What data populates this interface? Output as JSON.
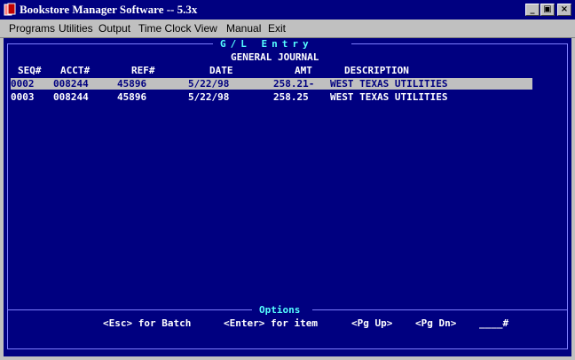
{
  "window": {
    "title": "Bookstore Manager Software -- 5.3x",
    "controls": [
      "_",
      "▣",
      "×"
    ]
  },
  "menu": [
    "Programs",
    "Utilities",
    "Output",
    "Time Clock",
    "View",
    "Manual",
    "Exit"
  ],
  "screen": {
    "frame_title": "G/L Entry",
    "subtitle": "GENERAL JOURNAL",
    "headers": {
      "seq": "SEQ#",
      "acct": "ACCT#",
      "ref": "REF#",
      "date": "DATE",
      "amt": "AMT",
      "desc": "DESCRIPTION"
    },
    "rows": [
      {
        "seq": "0002",
        "acct": "008244",
        "ref": "45896",
        "date": "5/22/98",
        "amt": "258.21-",
        "desc": "WEST TEXAS UTILITIES"
      },
      {
        "seq": "0003",
        "acct": "008244",
        "ref": "45896",
        "date": "5/22/98",
        "amt": "258.25",
        "desc": "WEST TEXAS UTILITIES"
      }
    ],
    "options_title": "Options",
    "options": {
      "esc": "<Esc> for Batch",
      "enter": "<Enter> for item",
      "pgup": "<Pg Up>",
      "pgdn": "<Pg Dn>",
      "goto": "____#"
    }
  }
}
